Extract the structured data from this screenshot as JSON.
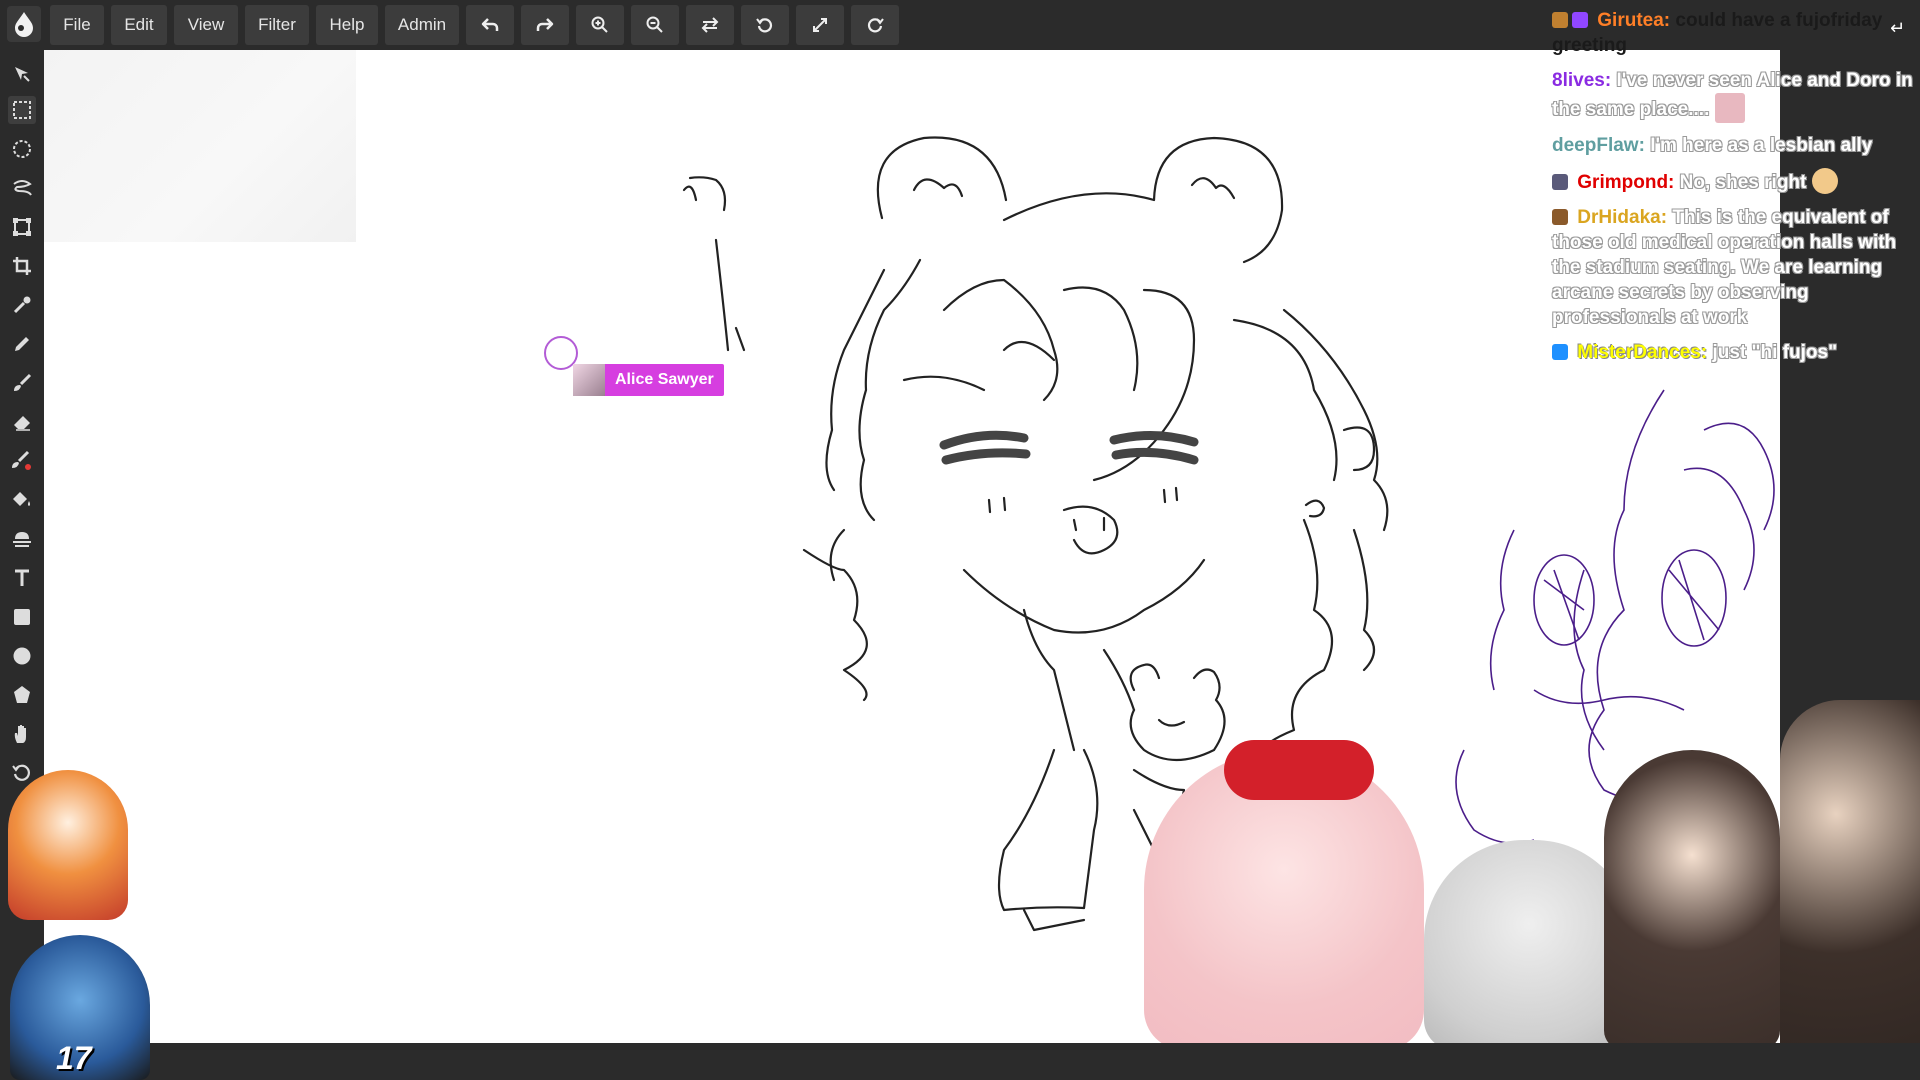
{
  "menubar": {
    "items": [
      {
        "label": "File"
      },
      {
        "label": "Edit"
      },
      {
        "label": "View"
      },
      {
        "label": "Filter"
      },
      {
        "label": "Help"
      },
      {
        "label": "Admin"
      }
    ],
    "tool_buttons": [
      "undo-icon",
      "redo-icon",
      "zoom-in-icon",
      "zoom-out-icon",
      "flip-icon",
      "rotate-ccw-icon",
      "fullscreen-icon",
      "rotate-cw-icon"
    ]
  },
  "toolbar": {
    "tools": [
      "move-icon",
      "rect-select-icon",
      "ellipse-select-icon",
      "lasso-icon",
      "transform-icon",
      "crop-icon",
      "eyedropper-icon",
      "pencil-icon",
      "brush-icon",
      "eraser-icon",
      "smudge-icon",
      "fill-icon",
      "blend-icon",
      "text-icon",
      "rectangle-icon",
      "circle-icon",
      "shape-icon",
      "hand-icon",
      "history-icon"
    ],
    "active_tool": "rect-select-icon",
    "accent_color": "#e53935"
  },
  "remote_cursor": {
    "username": "Alice Sawyer",
    "color": "#d63ee0"
  },
  "chat": {
    "messages": [
      {
        "name": "Girutea:",
        "text": "could have a fujofriday greeting",
        "name_color": "#ff7f27",
        "badge_color": "#9147ff",
        "text_style": "dark-first"
      },
      {
        "name": "8lives:",
        "text": "I've never seen Alice and Doro in the same place....",
        "name_color": "#8a2be2",
        "badge_color": "",
        "text_style": "light"
      },
      {
        "name": "deepFlaw:",
        "text": "I'm here as a lesbian ally",
        "name_color": "#5f9ea0",
        "badge_color": "",
        "text_style": "light"
      },
      {
        "name": "Grimpond:",
        "text": "No, shes right",
        "name_color": "#e00000",
        "badge_color": "#5a5a7a",
        "text_style": "light"
      },
      {
        "name": "DrHidaka:",
        "text": "This is the equivalent of those old medical operation halls with the stadium seating. We are learning arcane secrets by observing professionals at work",
        "name_color": "#daa520",
        "badge_color": "#8b5a2b",
        "text_style": "light"
      },
      {
        "name": "MisterDances:",
        "text": "just \"hi fujos\"",
        "name_color": "#ffff00",
        "badge_color": "#1e90ff",
        "text_style": "light"
      }
    ],
    "collapse_icon": "collapse-chat-icon"
  },
  "overlay": {
    "jersey_number": "17"
  }
}
